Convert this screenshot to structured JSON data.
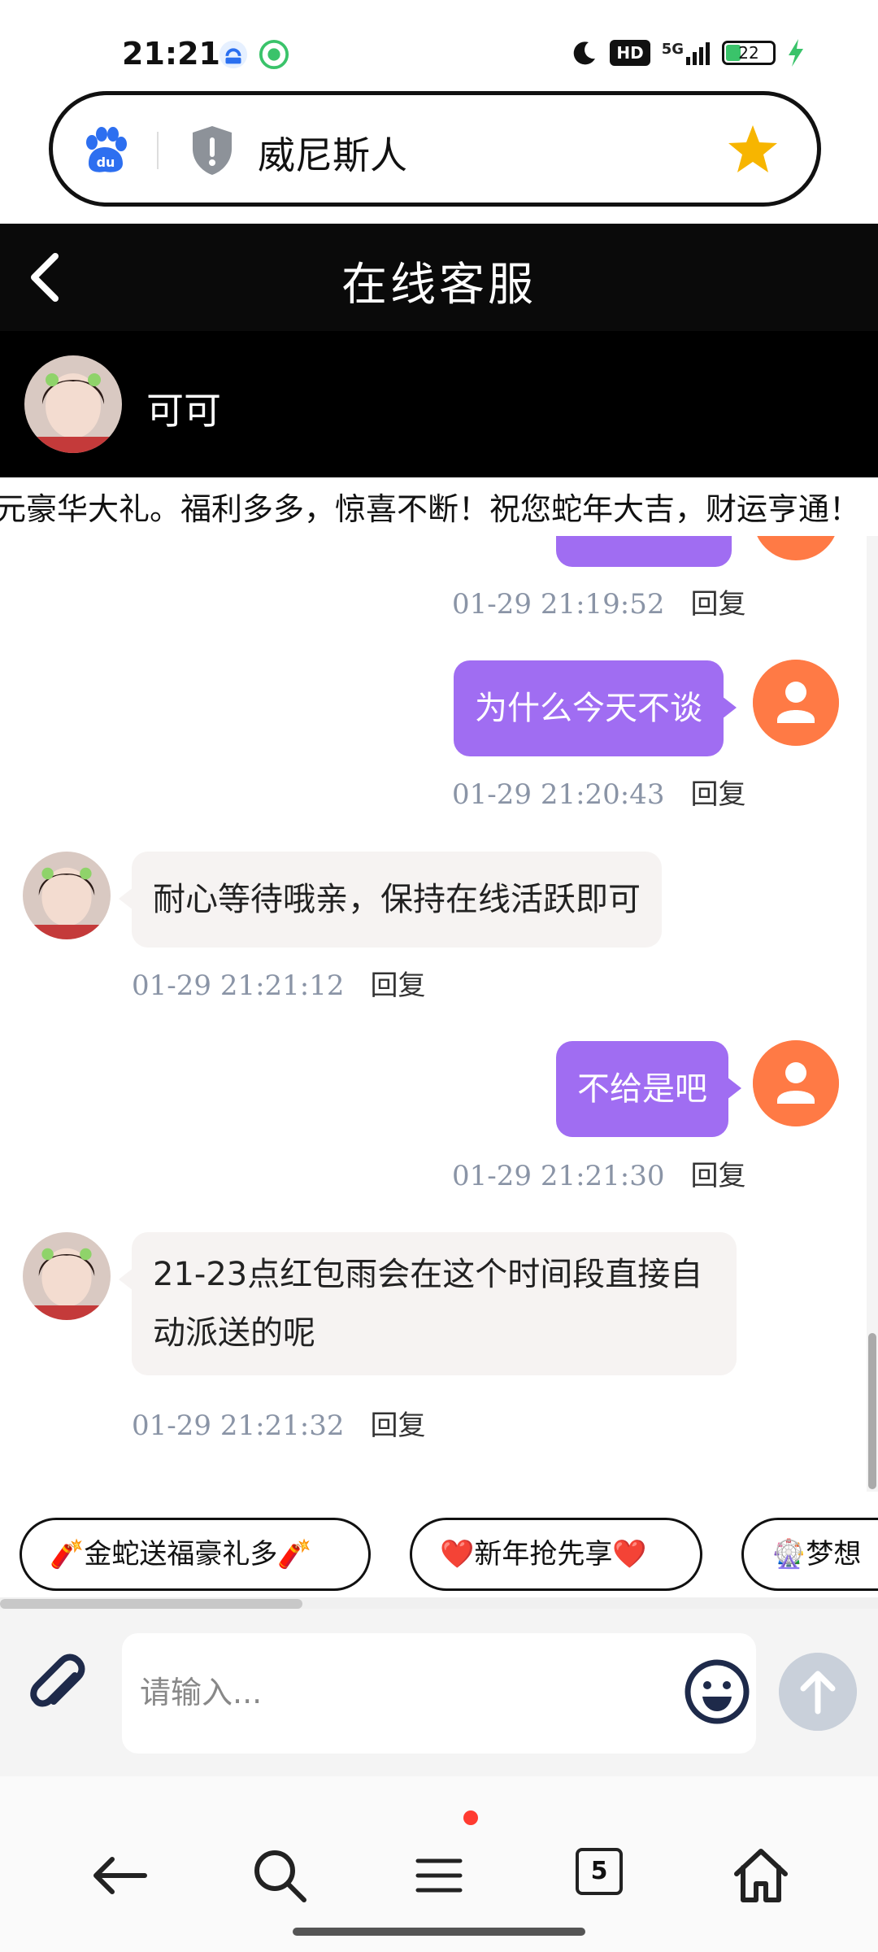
{
  "status_bar": {
    "time": "21:21",
    "network": "5G",
    "hd_label": "HD",
    "battery_level": "22"
  },
  "browser": {
    "page_title": "威尼斯人",
    "tab_count": "5"
  },
  "chat": {
    "header_title": "在线客服",
    "agent_name": "可可",
    "marquee_text": "元豪华大礼。福利多多，惊喜不断！祝您蛇年大吉，财运亨通！",
    "reply_label": "回复",
    "messages": [
      {
        "from": "user",
        "text": "",
        "time": "01-29 21:19:52"
      },
      {
        "from": "user",
        "text": "为什么今天不谈",
        "time": "01-29 21:20:43"
      },
      {
        "from": "agent",
        "text": "耐心等待哦亲，保持在线活跃即可",
        "time": "01-29 21:21:12"
      },
      {
        "from": "user",
        "text": "不给是吧",
        "time": "01-29 21:21:30"
      },
      {
        "from": "agent",
        "text": "21-23点红包雨会在这个时间段直接自动派送的呢",
        "time": "01-29 21:21:32"
      }
    ]
  },
  "quick_replies": [
    {
      "label": "🧨金蛇送福豪礼多🧨"
    },
    {
      "label": "❤️新年抢先享❤️"
    },
    {
      "label": "🎡梦想"
    }
  ],
  "input": {
    "placeholder": "请输入..."
  },
  "colors": {
    "user_bubble": "#a06df2",
    "agent_bubble": "#f6f3f2",
    "user_avatar": "#ff7a45",
    "header_bg": "#0a0a0a",
    "timestamp": "#8a94a6"
  }
}
